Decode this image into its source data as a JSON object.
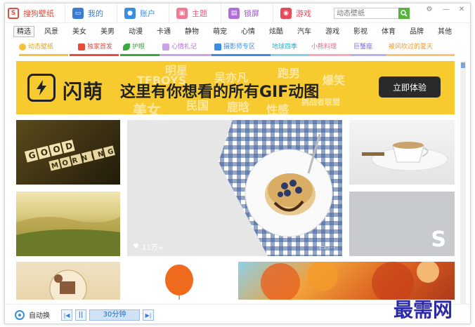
{
  "app": {
    "nav_tabs": [
      {
        "label": "搜狗壁纸",
        "icon": "sogou-logo-icon"
      },
      {
        "label": "我的",
        "icon": "monitor-icon"
      },
      {
        "label": "账户",
        "icon": "user-icon"
      },
      {
        "label": "主题",
        "icon": "theme-icon"
      },
      {
        "label": "锁屏",
        "icon": "lock-screen-icon"
      },
      {
        "label": "游戏",
        "icon": "gamepad-icon"
      }
    ],
    "search": {
      "placeholder": "动态壁纸"
    }
  },
  "categories": [
    "精选",
    "风景",
    "美女",
    "美男",
    "动漫",
    "卡通",
    "静物",
    "萌宠",
    "心情",
    "炫酷",
    "汽车",
    "游戏",
    "影视",
    "体育",
    "品牌",
    "其他"
  ],
  "sub_tabs": [
    {
      "label": "动态壁纸",
      "color": "#e8a400"
    },
    {
      "label": "独家首发",
      "color": "#e84a3c"
    },
    {
      "label": "护眼",
      "color": "#3aa83a"
    },
    {
      "label": "心情札记",
      "color": "#b070d8"
    },
    {
      "label": "摄影师专区",
      "color": "#3a8de0"
    },
    {
      "label": "地球四季",
      "color": "#2ab0c8"
    },
    {
      "label": "小熊料理",
      "color": "#e86a8c"
    },
    {
      "label": "巨蟹座",
      "color": "#7a6ad8"
    },
    {
      "label": "被风吹过的夏天",
      "color": "#f09a20"
    }
  ],
  "banner": {
    "brand": "闪萌",
    "headline": "这里有你想看的所有GIF动图",
    "cta": "立即体验",
    "bg_words": [
      "明星",
      "TFBOYS",
      "吴亦凡",
      "跑男",
      "爆笑",
      "美女",
      "民国",
      "鹿晗",
      "性感",
      "挑战者联盟"
    ]
  },
  "thumbs": {
    "good_morning": [
      "GOOD",
      "MORNING"
    ],
    "like_count": "11万+"
  },
  "bottom": {
    "auto_switch": "自动换",
    "interval": "30分钟"
  },
  "watermark": "最需网",
  "colors": {
    "accent": "#57b33c",
    "banner": "#f7cb2f",
    "selected": "#2b6cb5"
  }
}
